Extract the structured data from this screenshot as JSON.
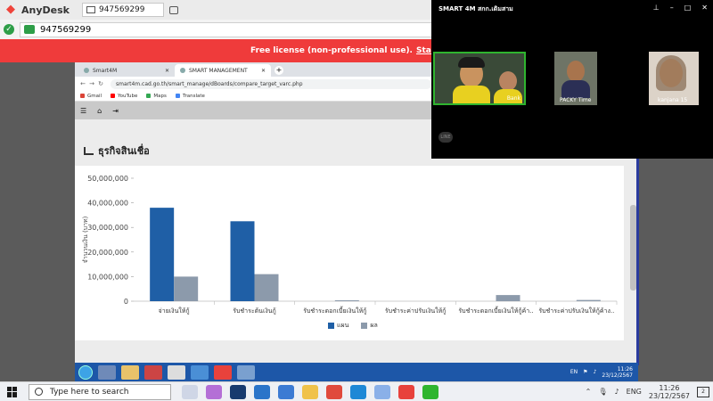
{
  "anydesk": {
    "app_title": "AnyDesk",
    "session_id": "947569299",
    "address_value": "947569299",
    "banner_text": "Free license (non-professional use).",
    "banner_link": "Start trial license"
  },
  "browser": {
    "tabs": [
      {
        "label": "Smart4M"
      },
      {
        "label": "SMART MANAGEMENT"
      }
    ],
    "url": "smart4m.cad.go.th/smart_manage/dBoards/compare_target_varc.php",
    "bookmarks": [
      {
        "label": "Gmail",
        "color": "#db4437"
      },
      {
        "label": "YouTube",
        "color": "#ff0000"
      },
      {
        "label": "Maps",
        "color": "#34a853"
      },
      {
        "label": "Translate",
        "color": "#4285f4"
      }
    ],
    "toolbar_icons": [
      "menu-icon",
      "home-icon",
      "exit-icon"
    ]
  },
  "page": {
    "section_title": "ธุรกิจสินเชื่อ"
  },
  "chart_data": {
    "type": "bar",
    "categories": [
      "จ่ายเงินให้กู้",
      "รับชำระต้นเงินกู้",
      "รับชำระดอกเบี้ยเงินให้กู้",
      "รับชำระค่าปรับเงินให้กู้",
      "รับชำระดอกเบี้ยเงินให้กู้ค้า..",
      "รับชำระค่าปรับเงินให้กู้ค้าง.."
    ],
    "series": [
      {
        "name": "แผน",
        "color": "#1f5fa6",
        "values": [
          38000000,
          32500000,
          0,
          0,
          0,
          0
        ]
      },
      {
        "name": "ผล",
        "color": "#8c9aab",
        "values": [
          10000000,
          11000000,
          250000,
          0,
          2500000,
          500000
        ]
      }
    ],
    "ylabel": "จำนวนเงิน (บาท)",
    "ylim": [
      0,
      50000000
    ],
    "yticks": [
      "0",
      "10,000,000",
      "20,000,000",
      "30,000,000",
      "40,000,000",
      "50,000,000"
    ],
    "ytick_values": [
      0,
      10000000,
      20000000,
      30000000,
      40000000,
      50000000
    ],
    "legend_position": "bottom-center",
    "grid": false
  },
  "remote_taskbar": {
    "lang": "EN",
    "time": "11:26",
    "date": "23/12/2567"
  },
  "video_call": {
    "title": "SMART 4M สกก.เดิมสาม",
    "participants": [
      {
        "name": "Bank"
      },
      {
        "name": "PACKY Time"
      },
      {
        "name": "kanjana 15"
      }
    ]
  },
  "host_taskbar": {
    "search_placeholder": "Type here to search",
    "lang": "ENG",
    "time": "11:26",
    "date": "23/12/2567"
  }
}
